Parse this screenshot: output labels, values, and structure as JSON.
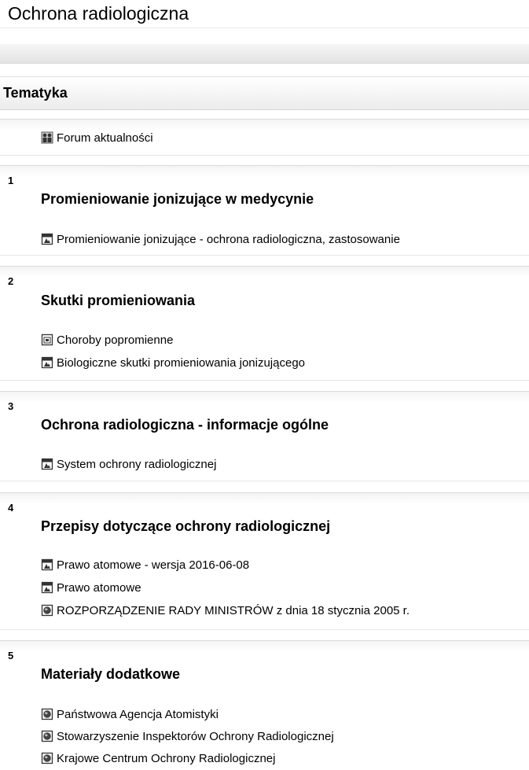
{
  "course": {
    "title": "Ochrona radiologiczna"
  },
  "topics_header": "Tematyka",
  "general": {
    "items": [
      {
        "label": "Forum aktualności",
        "icon": "forum-icon"
      }
    ]
  },
  "sections": [
    {
      "number": "1",
      "title": "Promieniowanie jonizujące w medycynie",
      "items": [
        {
          "label": "Promieniowanie jonizujące - ochrona radiologiczna, zastosowanie",
          "icon": "pdf-icon"
        }
      ]
    },
    {
      "number": "2",
      "title": "Skutki promieniowania",
      "items": [
        {
          "label": "Choroby popromienne",
          "icon": "page-icon"
        },
        {
          "label": "Biologiczne skutki promieniowania jonizującego",
          "icon": "pdf-icon"
        }
      ]
    },
    {
      "number": "3",
      "title": "Ochrona radiologiczna - informacje ogólne",
      "items": [
        {
          "label": "System ochrony radiologicznej",
          "icon": "pdf-icon"
        }
      ]
    },
    {
      "number": "4",
      "title": "Przepisy dotyczące ochrony radiologicznej",
      "items": [
        {
          "label": "Prawo atomowe - wersja 2016-06-08",
          "icon": "pdf-icon"
        },
        {
          "label": "Prawo atomowe",
          "icon": "pdf-icon"
        },
        {
          "label": "ROZPORZĄDZENIE RADY MINISTRÓW z dnia 18 stycznia 2005 r.",
          "icon": "url-icon"
        }
      ]
    },
    {
      "number": "5",
      "title": "Materiały dodatkowe",
      "items": [
        {
          "label": "Państwowa Agencja Atomistyki",
          "icon": "url-icon"
        },
        {
          "label": "Stowarzyszenie Inspektorów Ochrony Radiologicznej",
          "icon": "url-icon"
        },
        {
          "label": "Krajowe Centrum Ochrony Radiologicznej",
          "icon": "url-icon"
        }
      ]
    }
  ]
}
